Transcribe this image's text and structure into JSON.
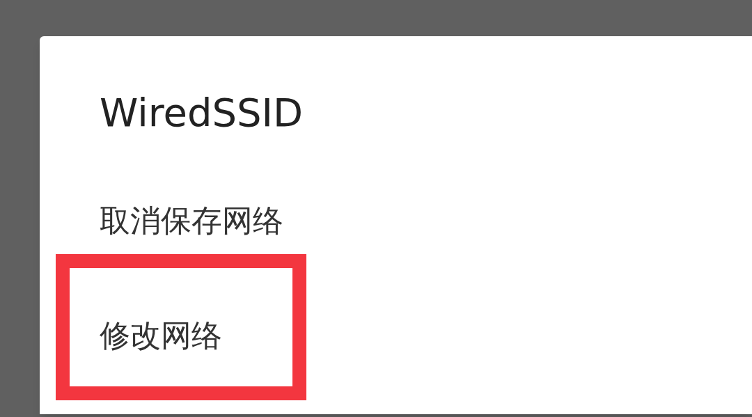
{
  "dialog": {
    "title": "WiredSSID",
    "items": [
      {
        "label": "取消保存网络",
        "highlighted": false
      },
      {
        "label": "修改网络",
        "highlighted": true
      }
    ]
  }
}
